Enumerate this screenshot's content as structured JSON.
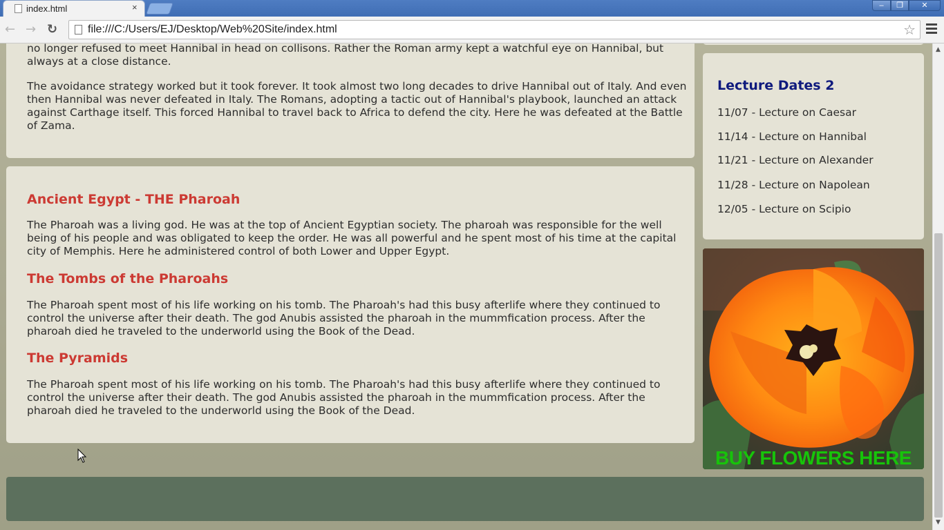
{
  "browser": {
    "tab_title": "index.html",
    "tab_close": "×",
    "url": "file:///C:/Users/EJ/Desktop/Web%20Site/index.html",
    "back_icon": "←",
    "forward_icon": "→",
    "reload_icon": "↻",
    "star_icon": "☆",
    "window_min": "–",
    "window_max": "❐",
    "window_close": "✕"
  },
  "content": {
    "top_paragraph_1": "no longer refused to meet Hannibal in head on collisons. Rather the Roman army kept a watchful eye on Hannibal, but always at a close distance.",
    "top_paragraph_2": "The avoidance strategy worked but it took forever. It took almost two long decades to drive Hannibal out of Italy. And even then Hannibal was never defeated in Italy. The Romans, adopting a tactic out of Hannibal's playbook, launched an attack against Carthage itself. This forced Hannibal to travel back to Africa to defend the city. Here he was defeated at the Battle of Zama.",
    "section_1_heading": "Ancient Egypt - THE Pharoah",
    "section_1_text": "The Pharoah was a living god. He was at the top of Ancient Egyptian society. The pharoah was responsible for the well being of his people and was obligated to keep the order. He was all powerful and he spent most of his time at the capital city of Memphis. Here he administered control of both Lower and Upper Egypt.",
    "section_2_heading": "The Tombs of the Pharoahs",
    "section_2_text": "The Pharoah spent most of his life working on his tomb. The Pharoah's had this busy afterlife where they continued to control the universe after their death. The god Anubis assisted the pharoah in the mummfication process. After the pharoah died he traveled to the underworld using the Book of the Dead.",
    "section_3_heading": "The Pyramids",
    "section_3_text": "The Pharoah spent most of his life working on his tomb. The Pharoah's had this busy afterlife where they continued to control the universe after their death. The god Anubis assisted the pharoah in the mummfication process. After the pharoah died he traveled to the underworld using the Book of the Dead."
  },
  "sidebar": {
    "title": "Lecture Dates 2",
    "dates": [
      "11/07 - Lecture on Caesar",
      "11/14 - Lecture on Hannibal",
      "11/21 - Lecture on Alexander",
      "11/28 - Lecture on Napolean",
      "12/05 - Lecture on Scipio"
    ],
    "ad_text": "BUY FLOWERS HERE"
  },
  "colors": {
    "heading_red": "#cc3a33",
    "sidebar_title_blue": "#0f1a7d",
    "ad_text_green": "#17c40a",
    "footer_green": "#5c705d",
    "panel_bg": "#e5e3d6"
  }
}
